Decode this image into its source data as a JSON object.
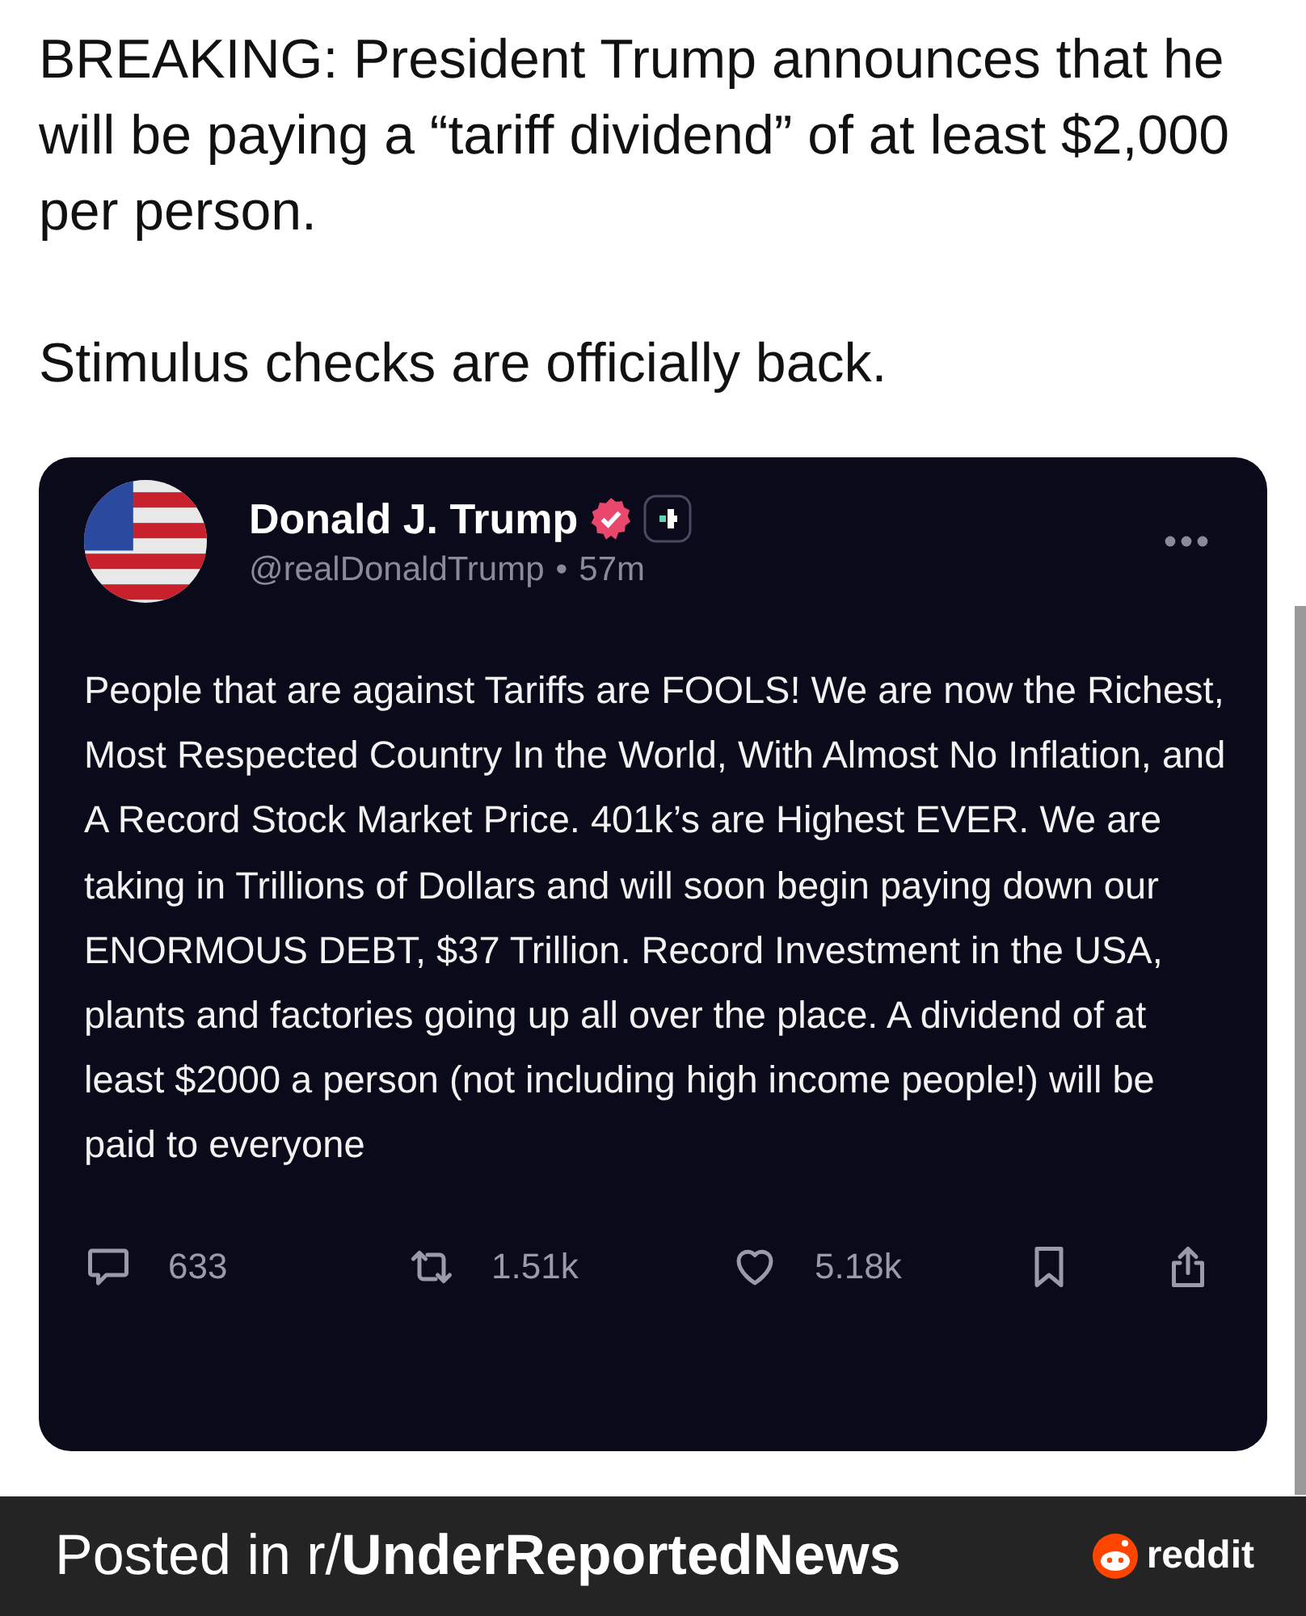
{
  "headline": [
    "BREAKING: President Trump announces that he will be paying a “tariff dividend” of at least $2,000 per person.",
    "Stimulus checks are officially back."
  ],
  "post": {
    "author": "Donald J. Trump",
    "verified": true,
    "handle": "@realDonaldTrump",
    "separator": "•",
    "time": "57m",
    "body": "People that are against Tariffs are FOOLS! We are now the Richest, Most Respected Country In the World, With Almost No Inflation, and A Record Stock Market Price. 401k’s are Highest EVER. We are taking in Trillions of Dollars and will soon begin paying down our ENORMOUS DEBT, $37 Trillion. Record Investment in the USA, plants and factories going up all over the place. A dividend of at least $2000 a person (not including high income people!) will be paid to everyone",
    "stats": [
      {
        "kind": "reply",
        "count": "633"
      },
      {
        "kind": "repost",
        "count": "1.51k"
      },
      {
        "kind": "like",
        "count": "5.18k"
      },
      {
        "kind": "bookmark"
      },
      {
        "kind": "share"
      }
    ]
  },
  "footer": {
    "posted_in": "Posted in r/**UnderReportedNews**",
    "brand": "reddit"
  }
}
